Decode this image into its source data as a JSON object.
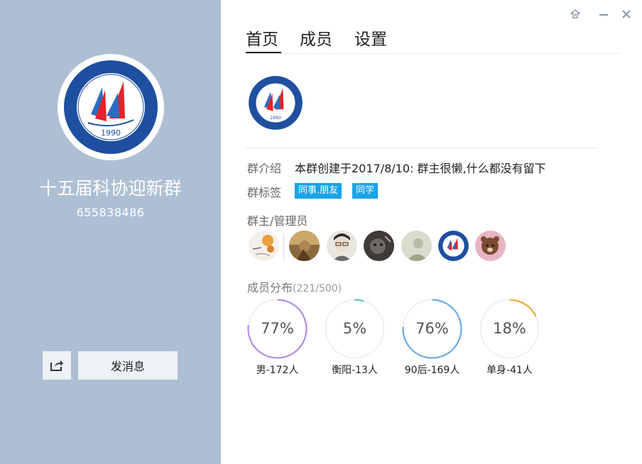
{
  "window_controls": {
    "pin_icon": "pin-icon",
    "min_icon": "minimize-icon",
    "close_icon": "close-icon"
  },
  "left_panel": {
    "group_name": "十五届科协迎新群",
    "group_id": "655838486",
    "share_icon": "share-icon",
    "send_message_label": "发消息",
    "logo_year": "1990"
  },
  "tabs": [
    {
      "label": "首页",
      "active": true
    },
    {
      "label": "成员",
      "active": false
    },
    {
      "label": "设置",
      "active": false
    }
  ],
  "info": {
    "intro_label": "群介绍",
    "intro_text": "本群创建于2017/8/10:  群主很懒,什么都没有留下",
    "tags_label": "群标签",
    "tags": [
      "同事.朋友",
      "同学"
    ],
    "admins_label": "群主/管理员",
    "admins": [
      {
        "name": "owner-avatar"
      },
      {
        "name": "admin-avatar-1"
      },
      {
        "name": "admin-avatar-2"
      },
      {
        "name": "admin-avatar-3"
      },
      {
        "name": "admin-avatar-4"
      },
      {
        "name": "admin-avatar-5"
      },
      {
        "name": "admin-avatar-6"
      }
    ]
  },
  "distribution": {
    "label": "成员分布",
    "count": "(221/500)",
    "stats": [
      {
        "percent_text": "77%",
        "value": 0.77,
        "caption": "男-172人",
        "color": "#b08ee0"
      },
      {
        "percent_text": "5%",
        "value": 0.05,
        "caption": "衡阳-13人",
        "color": "#5cc89a"
      },
      {
        "percent_text": "76%",
        "value": 0.76,
        "caption": "90后-169人",
        "color": "#6aaae8"
      },
      {
        "percent_text": "18%",
        "value": 0.18,
        "caption": "单身-41人",
        "color": "#f2aa3a"
      }
    ]
  }
}
